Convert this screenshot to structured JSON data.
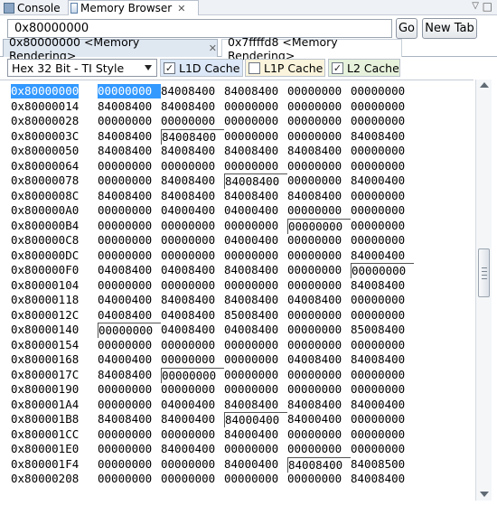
{
  "view_tabs": {
    "console": "Console",
    "memory_browser": "Memory Browser",
    "close": "✕",
    "menu": "▽",
    "minimize": "□"
  },
  "address_bar": {
    "value": "0x80000000",
    "go_label": "Go",
    "new_tab_label": "New Tab"
  },
  "render_tabs": [
    {
      "label": "0x80000000 <Memory Rendering>",
      "active": true,
      "close": "✕"
    },
    {
      "label": "0x7ffffd8 <Memory Rendering>",
      "active": false
    }
  ],
  "toolbar": {
    "format": "Hex 32 Bit - TI Style",
    "caches": [
      {
        "label": "L1D Cache",
        "checked": true,
        "color": "#dce8f7"
      },
      {
        "label": "L1P Cache",
        "checked": false,
        "color": "#fbf4dc"
      },
      {
        "label": "L2 Cache",
        "checked": true,
        "color": "#e6f2dc"
      }
    ]
  },
  "scrollbar": {
    "position_fraction": 0.45
  },
  "memory": {
    "selected_address": "0x80000000",
    "rows": [
      {
        "addr": "0x80000000",
        "cells": [
          "00000000",
          "84008400",
          "84008400",
          "00000000",
          "00000000"
        ],
        "sel": 0,
        "marks": []
      },
      {
        "addr": "0x80000014",
        "cells": [
          "84008400",
          "84008400",
          "00000000",
          "00000000",
          "00000000"
        ],
        "marks": []
      },
      {
        "addr": "0x80000028",
        "cells": [
          "00000000",
          "00000000",
          "00000000",
          "00000000",
          "00000000"
        ],
        "marks": []
      },
      {
        "addr": "0x8000003C",
        "cells": [
          "84008400",
          "84008400",
          "00000000",
          "00000000",
          "84008400"
        ],
        "marks": [
          1
        ]
      },
      {
        "addr": "0x80000050",
        "cells": [
          "84008400",
          "84008400",
          "84008400",
          "84008400",
          "00000000"
        ],
        "marks": []
      },
      {
        "addr": "0x80000064",
        "cells": [
          "00000000",
          "00000000",
          "00000000",
          "00000000",
          "00000000"
        ],
        "marks": []
      },
      {
        "addr": "0x80000078",
        "cells": [
          "00000000",
          "84008400",
          "84008400",
          "00000000",
          "84000400"
        ],
        "marks": [
          2
        ]
      },
      {
        "addr": "0x8000008C",
        "cells": [
          "84008400",
          "84008400",
          "84008400",
          "84008400",
          "00000000"
        ],
        "marks": []
      },
      {
        "addr": "0x800000A0",
        "cells": [
          "00000000",
          "04000400",
          "04000400",
          "00000000",
          "00000000"
        ],
        "marks": []
      },
      {
        "addr": "0x800000B4",
        "cells": [
          "00000000",
          "00000000",
          "00000000",
          "00000000",
          "00000000"
        ],
        "marks": [
          3
        ]
      },
      {
        "addr": "0x800000C8",
        "cells": [
          "00000000",
          "00000000",
          "04000400",
          "00000000",
          "00000000"
        ],
        "marks": []
      },
      {
        "addr": "0x800000DC",
        "cells": [
          "00000000",
          "00000000",
          "00000000",
          "00000000",
          "84000400"
        ],
        "marks": []
      },
      {
        "addr": "0x800000F0",
        "cells": [
          "04008400",
          "04008400",
          "84008400",
          "00000000",
          "00000000"
        ],
        "marks": [
          4
        ]
      },
      {
        "addr": "0x80000104",
        "cells": [
          "00000000",
          "00000000",
          "00000000",
          "00000000",
          "84008400"
        ],
        "marks": []
      },
      {
        "addr": "0x80000118",
        "cells": [
          "04000400",
          "84008400",
          "84008400",
          "04008400",
          "00000000"
        ],
        "marks": []
      },
      {
        "addr": "0x8000012C",
        "cells": [
          "04008400",
          "04008400",
          "85008400",
          "00000000",
          "00000000"
        ],
        "marks": []
      },
      {
        "addr": "0x80000140",
        "cells": [
          "00000000",
          "04008400",
          "04008400",
          "00000000",
          "85008400"
        ],
        "marks": [
          0
        ]
      },
      {
        "addr": "0x80000154",
        "cells": [
          "00000000",
          "00000000",
          "00000000",
          "00000000",
          "00000000"
        ],
        "marks": []
      },
      {
        "addr": "0x80000168",
        "cells": [
          "04000400",
          "00000000",
          "00000000",
          "04008400",
          "84008400"
        ],
        "marks": []
      },
      {
        "addr": "0x8000017C",
        "cells": [
          "84008400",
          "00000000",
          "00000000",
          "00000000",
          "00000000"
        ],
        "marks": [
          1
        ]
      },
      {
        "addr": "0x80000190",
        "cells": [
          "00000000",
          "00000000",
          "00000000",
          "00000000",
          "00000000"
        ],
        "marks": []
      },
      {
        "addr": "0x800001A4",
        "cells": [
          "00000000",
          "04000400",
          "84008400",
          "84008400",
          "84000400"
        ],
        "marks": []
      },
      {
        "addr": "0x800001B8",
        "cells": [
          "84008400",
          "84000400",
          "84000400",
          "84000400",
          "00000000"
        ],
        "marks": [
          2
        ]
      },
      {
        "addr": "0x800001CC",
        "cells": [
          "00000000",
          "00000000",
          "84000400",
          "00000000",
          "00000000"
        ],
        "marks": []
      },
      {
        "addr": "0x800001E0",
        "cells": [
          "00000000",
          "84000400",
          "00000000",
          "00000000",
          "00000000"
        ],
        "marks": []
      },
      {
        "addr": "0x800001F4",
        "cells": [
          "00000000",
          "00000000",
          "84000400",
          "84008400",
          "84008500"
        ],
        "marks": [
          3
        ]
      },
      {
        "addr": "0x80000208",
        "cells": [
          "00000000",
          "00000000",
          "00000000",
          "00000000",
          "84008400"
        ],
        "marks": []
      }
    ]
  }
}
